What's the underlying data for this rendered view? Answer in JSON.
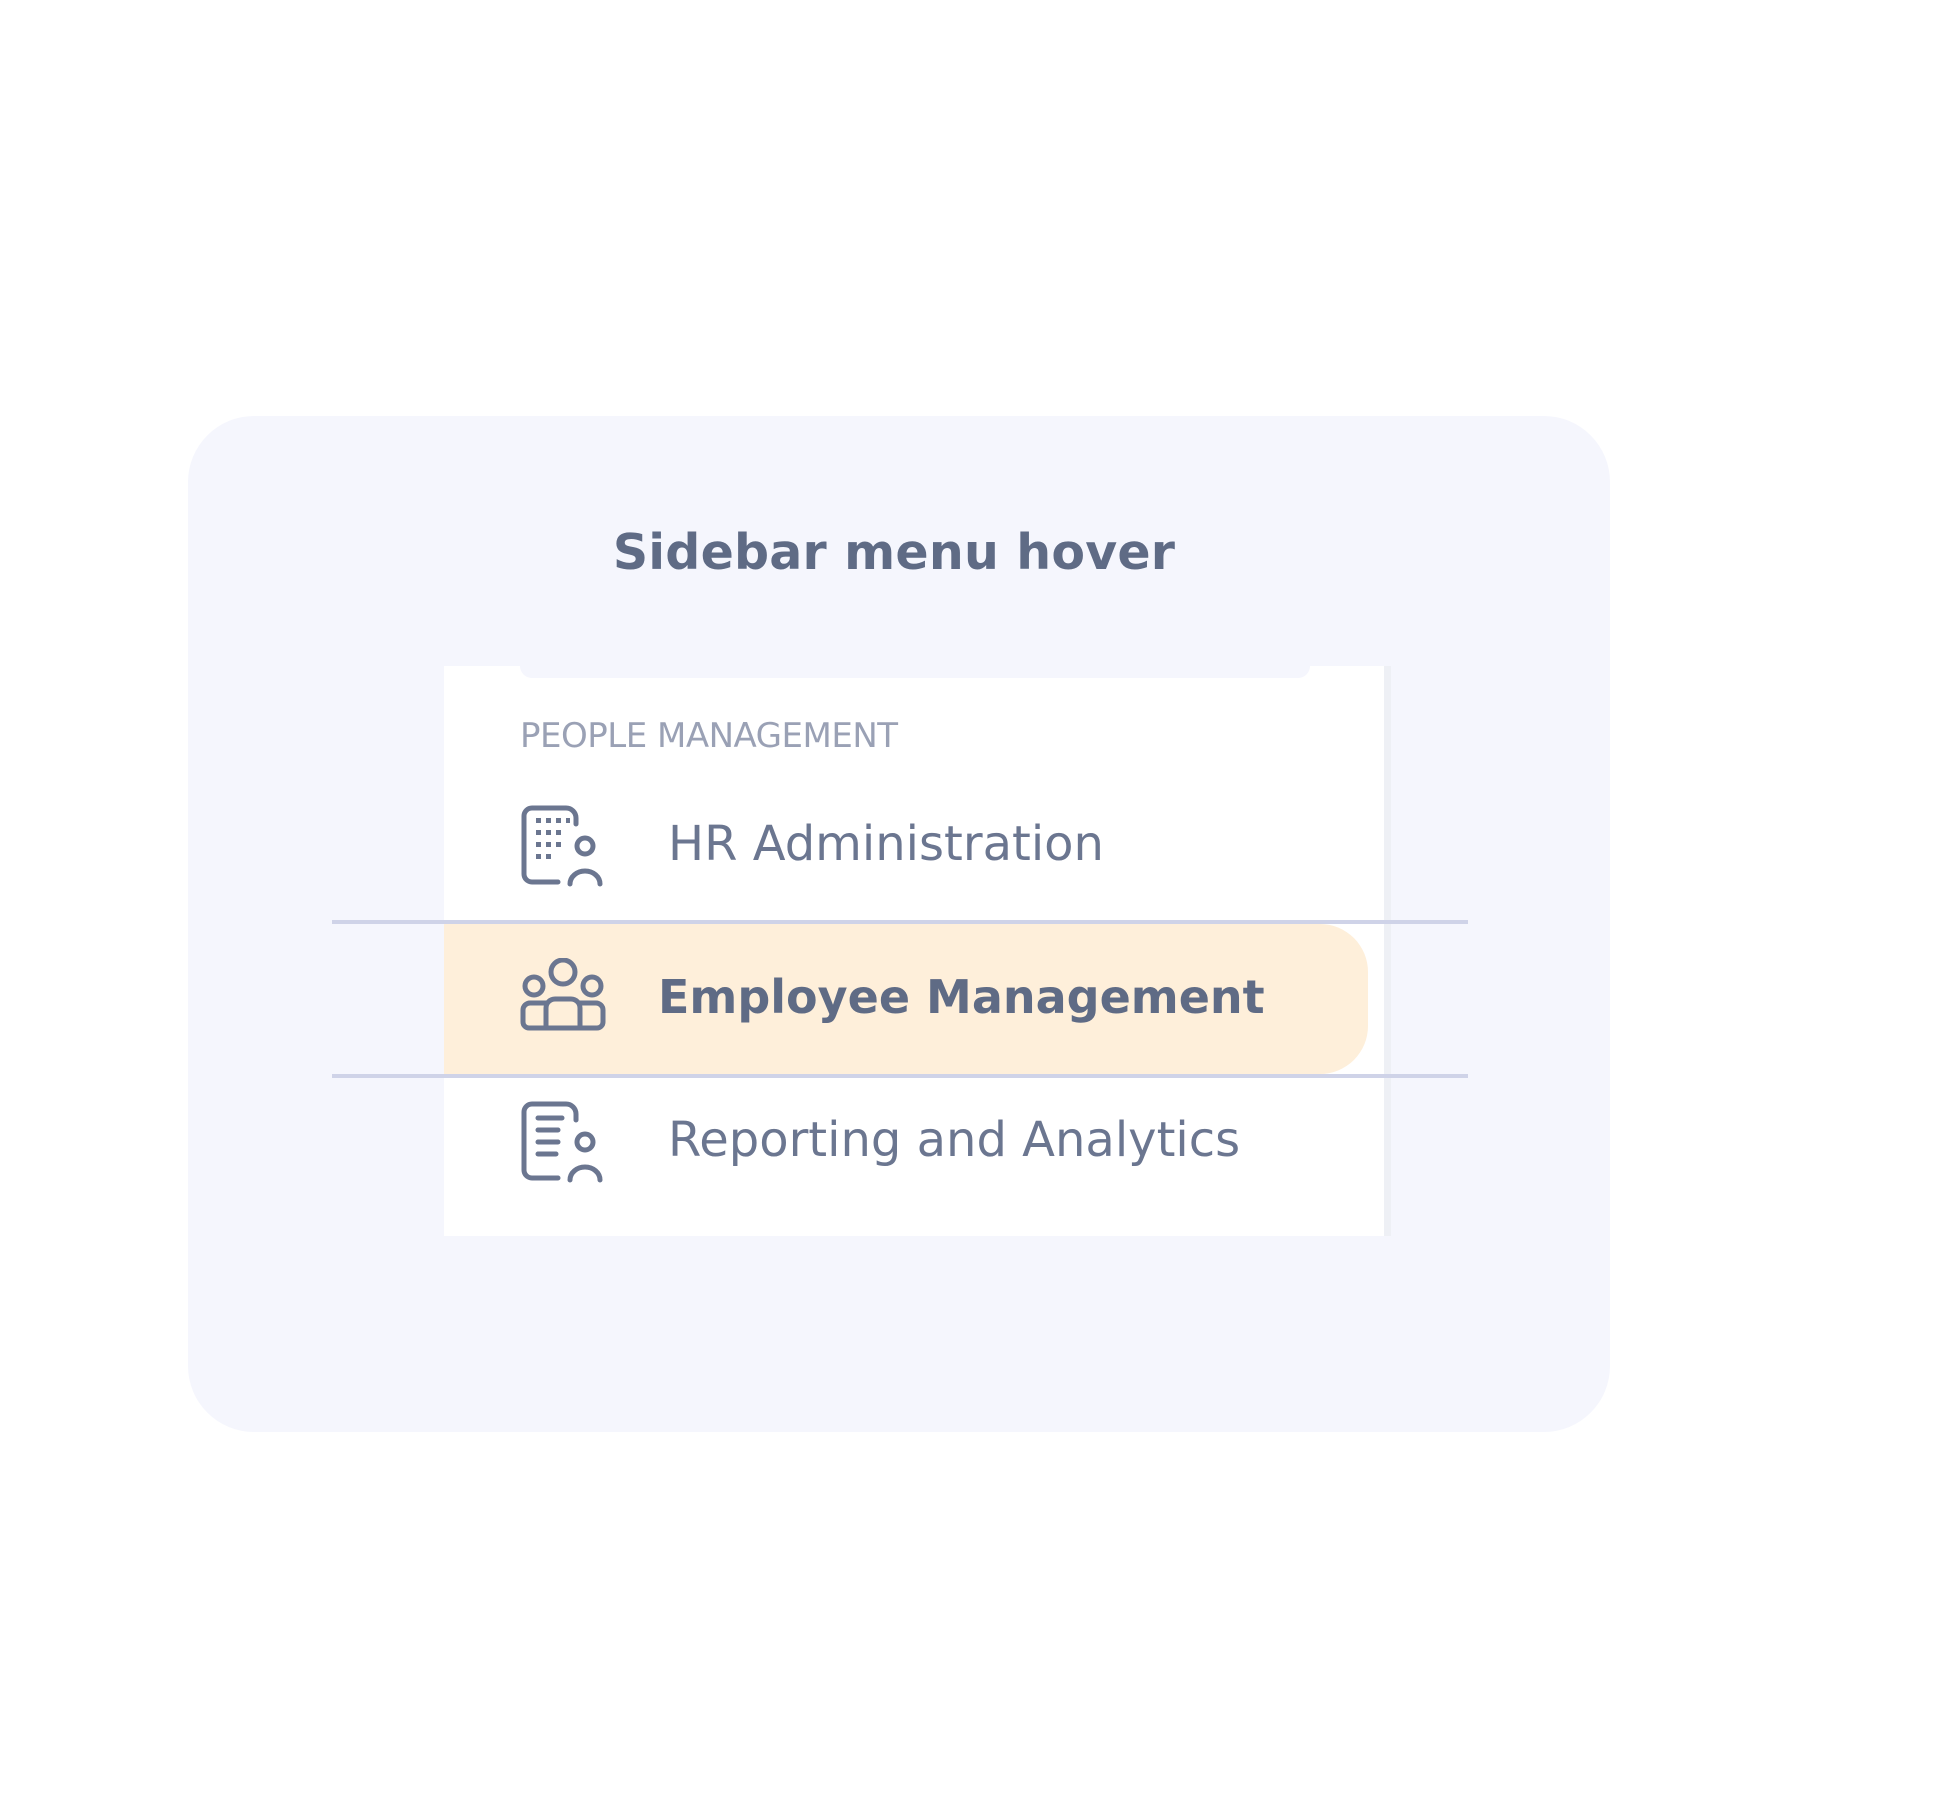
{
  "card": {
    "title": "Sidebar menu hover"
  },
  "sidebar": {
    "section_label": "PEOPLE MANAGEMENT",
    "items": [
      {
        "label": "HR Administration",
        "icon": "building-user-icon",
        "state": "default"
      },
      {
        "label": "Employee Management",
        "icon": "users-group-icon",
        "state": "hover"
      },
      {
        "label": "Reporting and Analytics",
        "icon": "report-user-icon",
        "state": "default"
      }
    ]
  },
  "colors": {
    "card_background": "#f5f6fd",
    "panel_background": "#ffffff",
    "hover_background": "#feefda",
    "text": "#6b7690",
    "section_label": "#9aa1b5",
    "guide_line": "#cfd3e8"
  }
}
